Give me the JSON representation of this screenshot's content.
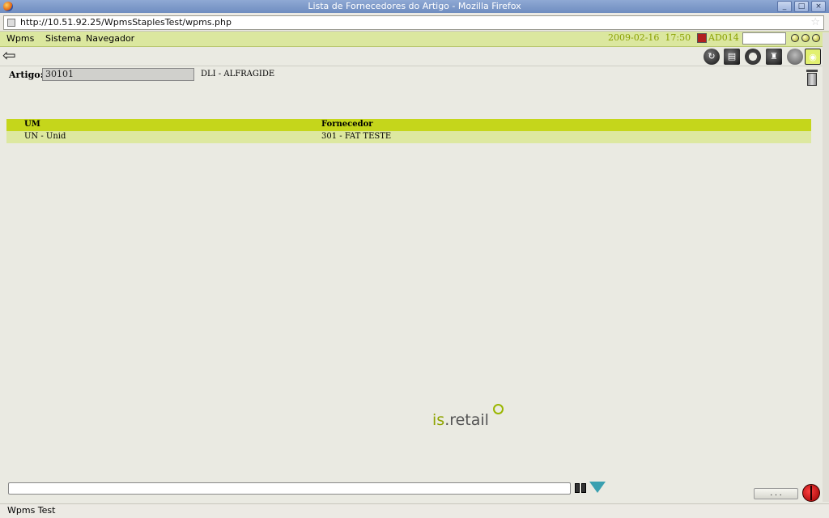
{
  "window": {
    "title": "Lista de Fornecedores do Artigo - Mozilla Firefox"
  },
  "browser": {
    "url": "http://10.51.92.25/WpmsStaplesTest/wpms.php",
    "status": "Wpms Test"
  },
  "menubar": {
    "items": [
      "Wpms",
      "Sistema",
      "Navegador"
    ],
    "date": "2009-02-16",
    "time": "17:50",
    "user_code": "AD014"
  },
  "form": {
    "artigo_label": "Artigo:",
    "artigo_value": "30101",
    "artigo_desc": "DLI - ALFRAGIDE"
  },
  "grid": {
    "columns": [
      "UM",
      "Fornecedor"
    ],
    "rows": [
      [
        "UN - Unid",
        "301 - FAT TESTE"
      ]
    ]
  },
  "footer": {
    "logo_prefix": "is",
    "logo_suffix": ".retail",
    "dots_label": ". . ."
  },
  "icons": [
    "back-arrow-icon",
    "refresh-icon",
    "print-icon",
    "lifebuoy-icon",
    "stamp-icon",
    "user-icon",
    "home-icon",
    "trash-icon",
    "binoculars-icon",
    "filter-icon",
    "bug-icon"
  ],
  "colors": {
    "accent": "#c5d61b",
    "row": "#dde8a0",
    "menubar": "#dbe79f",
    "datetime": "#8aa000"
  }
}
